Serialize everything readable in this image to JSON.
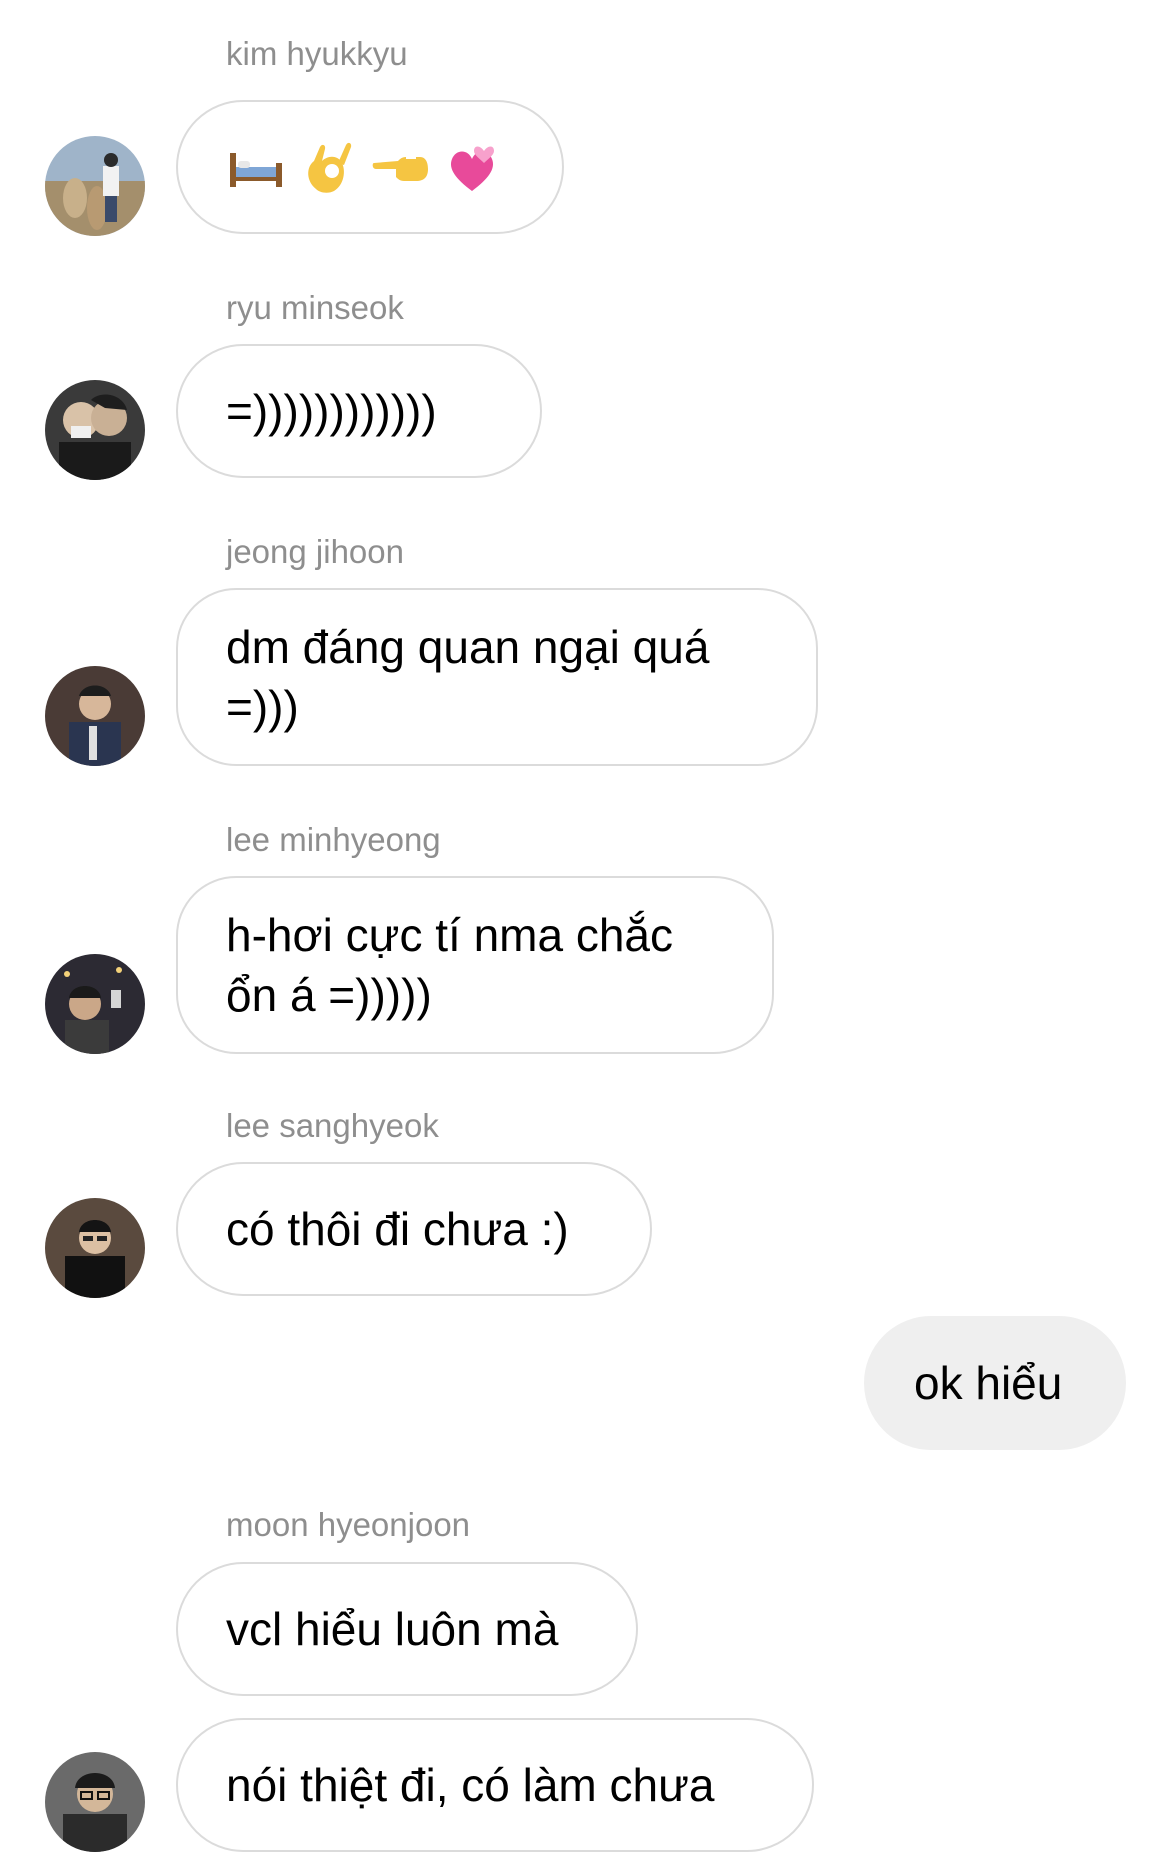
{
  "messages": [
    {
      "sender": "kim hyukkyu",
      "emojis": [
        "bed-emoji",
        "ok-hand-emoji",
        "backhand-index-pointing-left-emoji",
        "revolving-hearts-emoji"
      ],
      "text": "🛏️👌👈💞"
    },
    {
      "sender": "ryu minseok",
      "text": "=))))))))))))"
    },
    {
      "sender": "jeong jihoon",
      "text": "dm đáng quan ngại quá\n=)))"
    },
    {
      "sender": "lee minhyeong",
      "text": "h-hơi cực tí nma chắc\nổn á =)))))"
    },
    {
      "sender": "lee sanghyeok",
      "text": "có thôi đi chưa :)"
    },
    {
      "sender": "me",
      "text": "ok hiểu"
    },
    {
      "sender": "moon hyeonjoon",
      "text": "vcl hiểu luôn mà"
    },
    {
      "sender": "moon hyeonjoon",
      "text": "nói thiệt đi, có làm chưa"
    }
  ],
  "colors": {
    "sender_name": "#8e8e8e",
    "bubble_border": "#dbdbdb",
    "own_bubble": "#efefef",
    "text": "#000000",
    "background": "#ffffff"
  }
}
